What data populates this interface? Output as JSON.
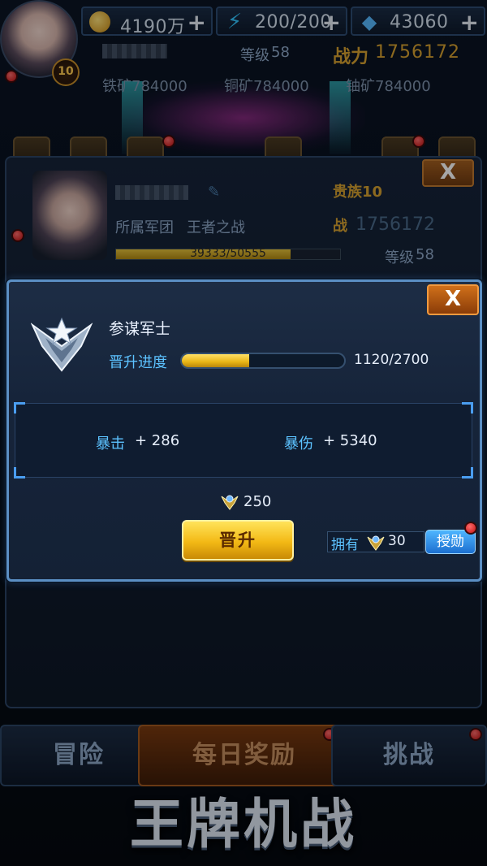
{
  "resources": {
    "gold": {
      "value": "4190万",
      "icon": "coin-icon"
    },
    "energy": {
      "value": "200/200",
      "icon": "lightning-icon"
    },
    "diamonds": {
      "value": "43060",
      "icon": "diamond-icon"
    },
    "add_symbol": "+"
  },
  "player": {
    "vip_badge": "10",
    "level_label": "等级",
    "level": "58",
    "power_label": "战力",
    "power": "1756172",
    "iron_ore": "铁矿784000",
    "copper_ore": "铜矿784000",
    "uranium_ore": "铀矿784000"
  },
  "info_panel": {
    "close_symbol": "X",
    "nobility": "贵族10",
    "legion_label": "所属军团",
    "legion": "王者之战",
    "battle_label": "战",
    "battle_power": "1756172",
    "xp_text": "39333/50555",
    "level_label": "等级",
    "level": "58"
  },
  "promotion": {
    "close_symbol": "X",
    "rank_name": "参谋军士",
    "progress_label": "晋升进度",
    "progress_value": "1120/2700",
    "progress_fraction": 0.415,
    "stats": [
      {
        "label": "暴击",
        "value": "+ 286"
      },
      {
        "label": "暴伤",
        "value": "+ 5340"
      }
    ],
    "cost": "250",
    "promote_label": "晋升",
    "own_label": "拥有",
    "own_value": "30",
    "medal_button": "授勋"
  },
  "nav": {
    "adventure": "冒险",
    "daily_reward": "每日奖励",
    "challenge": "挑战"
  },
  "logo_text": "王牌机战",
  "colors": {
    "accent_blue": "#5cc2ff",
    "gold": "#d7a230",
    "promote_yellow": "#f3b915",
    "close_orange": "#d0701a"
  }
}
